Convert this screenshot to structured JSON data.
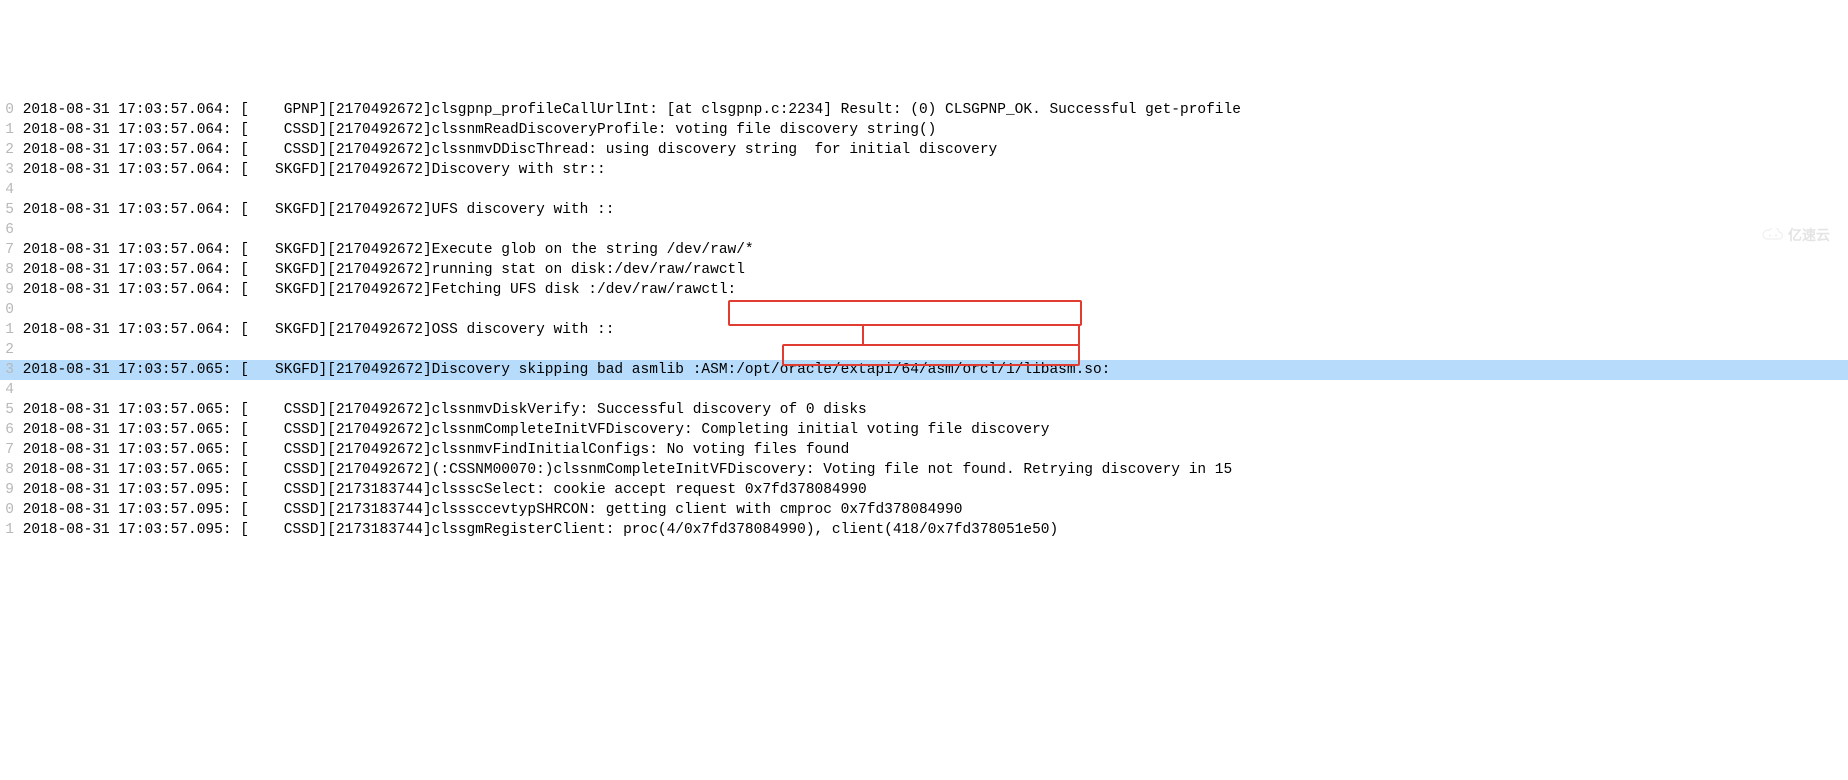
{
  "watermark": "亿速云",
  "lines": [
    {
      "num": "0",
      "text": "2018-08-31 17:03:57.064: [    GPNP][2170492672]clsgpnp_profileCallUrlInt: [at clsgpnp.c:2234] Result: (0) CLSGPNP_OK. Successful get-profile",
      "selected": false
    },
    {
      "num": "1",
      "text": "2018-08-31 17:03:57.064: [    CSSD][2170492672]clssnmReadDiscoveryProfile: voting file discovery string()",
      "selected": false
    },
    {
      "num": "2",
      "text": "2018-08-31 17:03:57.064: [    CSSD][2170492672]clssnmvDDiscThread: using discovery string  for initial discovery",
      "selected": false
    },
    {
      "num": "3",
      "text": "2018-08-31 17:03:57.064: [   SKGFD][2170492672]Discovery with str::",
      "selected": false
    },
    {
      "num": "4",
      "text": "",
      "selected": false
    },
    {
      "num": "5",
      "text": "2018-08-31 17:03:57.064: [   SKGFD][2170492672]UFS discovery with ::",
      "selected": false
    },
    {
      "num": "6",
      "text": "",
      "selected": false
    },
    {
      "num": "7",
      "text": "2018-08-31 17:03:57.064: [   SKGFD][2170492672]Execute glob on the string /dev/raw/*",
      "selected": false
    },
    {
      "num": "8",
      "text": "2018-08-31 17:03:57.064: [   SKGFD][2170492672]running stat on disk:/dev/raw/rawctl",
      "selected": false
    },
    {
      "num": "9",
      "text": "2018-08-31 17:03:57.064: [   SKGFD][2170492672]Fetching UFS disk :/dev/raw/rawctl:",
      "selected": false
    },
    {
      "num": "0",
      "text": "",
      "selected": false
    },
    {
      "num": "1",
      "text": "2018-08-31 17:03:57.064: [   SKGFD][2170492672]OSS discovery with ::",
      "selected": false
    },
    {
      "num": "2",
      "text": "",
      "selected": false
    },
    {
      "num": "3",
      "text": "2018-08-31 17:03:57.065: [   SKGFD][2170492672]Discovery skipping bad asmlib :ASM:/opt/oracle/extapi/64/asm/orcl/1/libasm.so:",
      "selected": true
    },
    {
      "num": "4",
      "text": "",
      "selected": false
    },
    {
      "num": "5",
      "text": "2018-08-31 17:03:57.065: [    CSSD][2170492672]clssnmvDiskVerify: Successful discovery of 0 disks",
      "selected": false
    },
    {
      "num": "6",
      "text": "2018-08-31 17:03:57.065: [    CSSD][2170492672]clssnmCompleteInitVFDiscovery: Completing initial voting file discovery",
      "selected": false
    },
    {
      "num": "7",
      "text": "2018-08-31 17:03:57.065: [    CSSD][2170492672]clssnmvFindInitialConfigs: No voting files found",
      "selected": false
    },
    {
      "num": "8",
      "text": "2018-08-31 17:03:57.065: [    CSSD][2170492672](:CSSNM00070:)clssnmCompleteInitVFDiscovery: Voting file not found. Retrying discovery in 15",
      "selected": false
    },
    {
      "num": "9",
      "text": "2018-08-31 17:03:57.095: [    CSSD][2173183744]clssscSelect: cookie accept request 0x7fd378084990",
      "selected": false
    },
    {
      "num": "0",
      "text": "2018-08-31 17:03:57.095: [    CSSD][2173183744]clsssccevtypSHRCON: getting client with cmproc 0x7fd378084990",
      "selected": false
    },
    {
      "num": "1",
      "text": "2018-08-31 17:03:57.095: [    CSSD][2173183744]clssgmRegisterClient: proc(4/0x7fd378084990), client(418/0x7fd378051e50)",
      "selected": false
    }
  ],
  "highlights": [
    {
      "text": "Successful discovery of 0 disks"
    },
    {
      "text": "Completing initial"
    },
    {
      "text": "gs: No voting files found"
    }
  ]
}
